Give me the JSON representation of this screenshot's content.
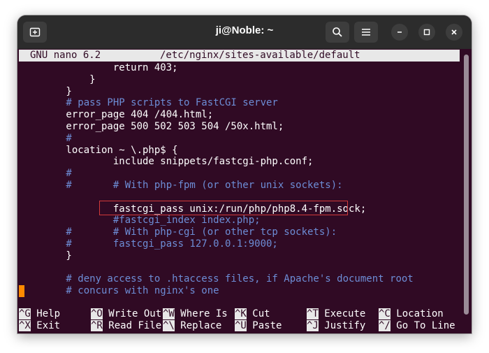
{
  "window": {
    "title": "ji@Noble: ~"
  },
  "nano": {
    "version": "GNU nano 6.2",
    "file": "/etc/nginx/sites-available/default"
  },
  "lines": [
    {
      "text": "                return 403;",
      "comment": false
    },
    {
      "text": "            }",
      "comment": false
    },
    {
      "text": "        }",
      "comment": false
    },
    {
      "text": "        # pass PHP scripts to FastCGI server",
      "comment": true
    },
    {
      "text": "        error_page 404 /404.html;",
      "comment": false
    },
    {
      "text": "        error_page 500 502 503 504 /50x.html;",
      "comment": false
    },
    {
      "text": "        #",
      "comment": true
    },
    {
      "text": "        location ~ \\.php$ {",
      "comment": false
    },
    {
      "text": "                include snippets/fastcgi-php.conf;",
      "comment": false
    },
    {
      "text": "        #",
      "comment": true
    },
    {
      "text": "        #       # With php-fpm (or other unix sockets):",
      "comment": true
    },
    {
      "text": "",
      "comment": false
    },
    {
      "text": "                fastcgi_pass unix:/run/php/php8.4-fpm.sock;",
      "comment": false
    },
    {
      "text": "                #fastcgi_index index.php;",
      "comment": true
    },
    {
      "text": "        #       # With php-cgi (or other tcp sockets):",
      "comment": true
    },
    {
      "text": "        #       fastcgi_pass 127.0.0.1:9000;",
      "comment": true
    },
    {
      "text": "        }",
      "comment": false
    },
    {
      "text": "",
      "comment": false
    },
    {
      "text": "        # deny access to .htaccess files, if Apache's document root",
      "comment": true
    },
    {
      "text": "        # concurs with nginx's one",
      "comment": true
    }
  ],
  "shortcuts": [
    {
      "key": "^G",
      "label": "Help"
    },
    {
      "key": "^O",
      "label": "Write Out"
    },
    {
      "key": "^W",
      "label": "Where Is"
    },
    {
      "key": "^K",
      "label": "Cut"
    },
    {
      "key": "^T",
      "label": "Execute"
    },
    {
      "key": "^C",
      "label": "Location"
    },
    {
      "key": "^X",
      "label": "Exit"
    },
    {
      "key": "^R",
      "label": "Read File"
    },
    {
      "key": "^\\",
      "label": "Replace"
    },
    {
      "key": "^U",
      "label": "Paste"
    },
    {
      "key": "^J",
      "label": "Justify"
    },
    {
      "key": "^/",
      "label": "Go To Line"
    }
  ],
  "colors": {
    "background": "#300a24",
    "comment": "#6d8dd6",
    "highlight_border": "#d23a3a",
    "cursor": "#ff8a00"
  },
  "icons": {
    "new_tab": "new-tab-icon",
    "search": "search-icon",
    "menu": "hamburger-menu-icon",
    "minimize": "minimize-icon",
    "maximize": "maximize-icon",
    "close": "close-icon"
  }
}
